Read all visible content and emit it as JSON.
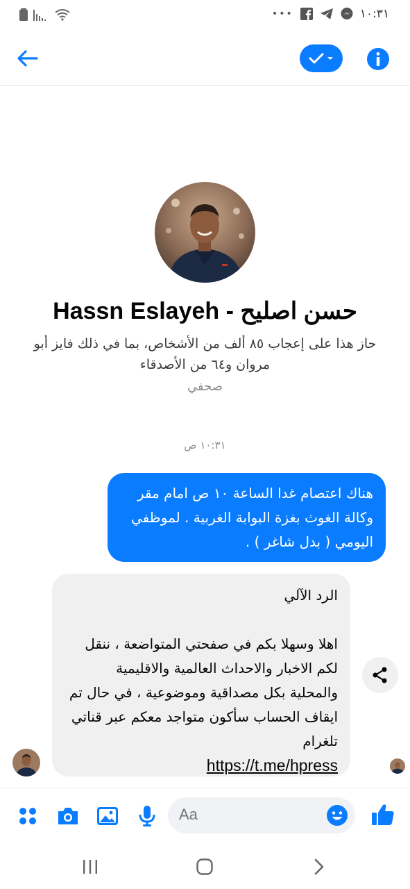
{
  "status_bar": {
    "time": "١٠:٣١",
    "dots": "•••",
    "icons": [
      "battery-icon",
      "signal-icon",
      "wifi-icon",
      "facebook-icon",
      "telegram-icon",
      "messenger-icon"
    ]
  },
  "header": {
    "back_icon": "back-arrow-icon",
    "check_icon": "check-icon",
    "info_icon": "info-icon"
  },
  "profile": {
    "name": "Hassn Eslayeh - حسن اصليح",
    "likes": "حاز هذا على إعجاب ٨٥ ألف من الأشخاص، بما في ذلك فايز أبو مروان و٦٤ من الأصدقاء",
    "role": "صحفي"
  },
  "conversation": {
    "timestamp": "١٠:٣١ ص",
    "messages": [
      {
        "direction": "outgoing",
        "text": "هناك اعتصام  غدا  الساعة ١٠ ص امام مقر وكالة الغوث بغزة  البوابة  الغربية  . لموظفي اليومي ( بدل شاغر ) ."
      },
      {
        "direction": "incoming",
        "title": "الرد الآلي",
        "text": "اهلا وسهلا بكم في صفحتي المتواضعة ، ننقل لكم الاخبار والاحداث العالمية والاقليمية والمحلية بكل مصداقية وموضوعية ، في حال تم ايقاف الحساب سأكون متواجد معكم عبر قناتي تلغرام",
        "link": "https://t.me/hpress"
      }
    ]
  },
  "composer": {
    "placeholder": "Aa",
    "icons": [
      "apps-icon",
      "camera-icon",
      "gallery-icon",
      "microphone-icon",
      "emoji-icon",
      "thumbs-up-icon"
    ]
  },
  "colors": {
    "accent": "#0a7cff",
    "incoming_bubble": "#f0f0f0",
    "muted_text": "#8a8d91"
  }
}
